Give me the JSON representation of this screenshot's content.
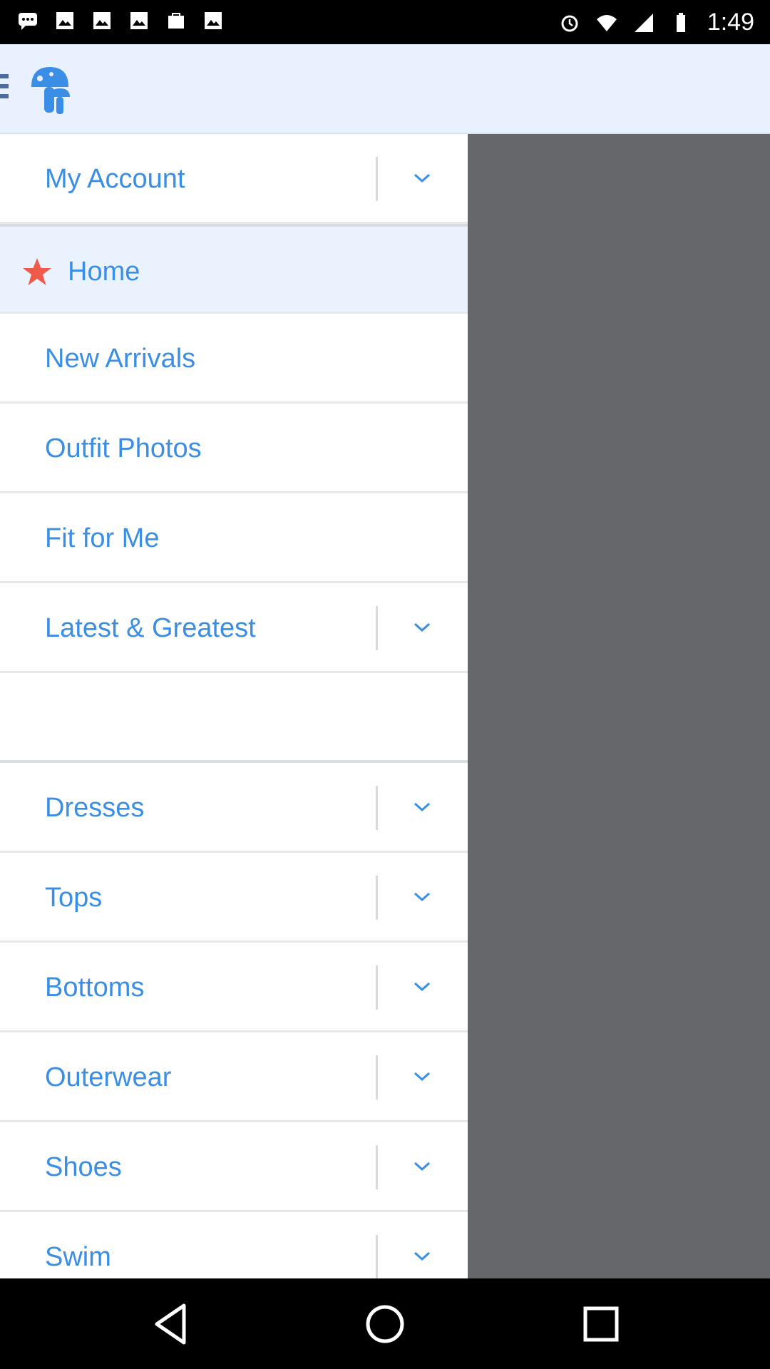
{
  "status_bar": {
    "time": "1:49",
    "left_icons": [
      "chat-icon",
      "image-icon",
      "image-icon",
      "image-icon",
      "store-icon",
      "image-icon"
    ],
    "right_icons": [
      "alarm-icon",
      "wifi-icon",
      "signal-icon",
      "battery-icon"
    ]
  },
  "app_bar": {
    "menu_icon": "hamburger-icon",
    "logo_icon": "mushroom-logo-icon",
    "colors": {
      "background": "#e8f1fd",
      "logo": "#3a8ee6"
    }
  },
  "drawer": {
    "items": [
      {
        "label": "My Account",
        "expandable": true
      },
      {
        "label": "Home",
        "expandable": false,
        "selected": true,
        "icon": "star-icon"
      },
      {
        "label": "New Arrivals",
        "expandable": false
      },
      {
        "label": "Outfit Photos",
        "expandable": false
      },
      {
        "label": "Fit for Me",
        "expandable": false
      },
      {
        "label": "Latest & Greatest",
        "expandable": true
      },
      {
        "label": "",
        "expandable": false,
        "blank": true
      },
      {
        "label": "Dresses",
        "expandable": true
      },
      {
        "label": "Tops",
        "expandable": true
      },
      {
        "label": "Bottoms",
        "expandable": true
      },
      {
        "label": "Outerwear",
        "expandable": true
      },
      {
        "label": "Shoes",
        "expandable": true
      },
      {
        "label": "Swim",
        "expandable": true
      }
    ],
    "colors": {
      "label": "#3a8ee6",
      "star": "#f05a4a",
      "selected_bg": "#eaf3fd",
      "scrim": "#66676a"
    }
  },
  "nav_bar": {
    "buttons": [
      "back-icon",
      "home-icon",
      "recents-icon"
    ]
  }
}
